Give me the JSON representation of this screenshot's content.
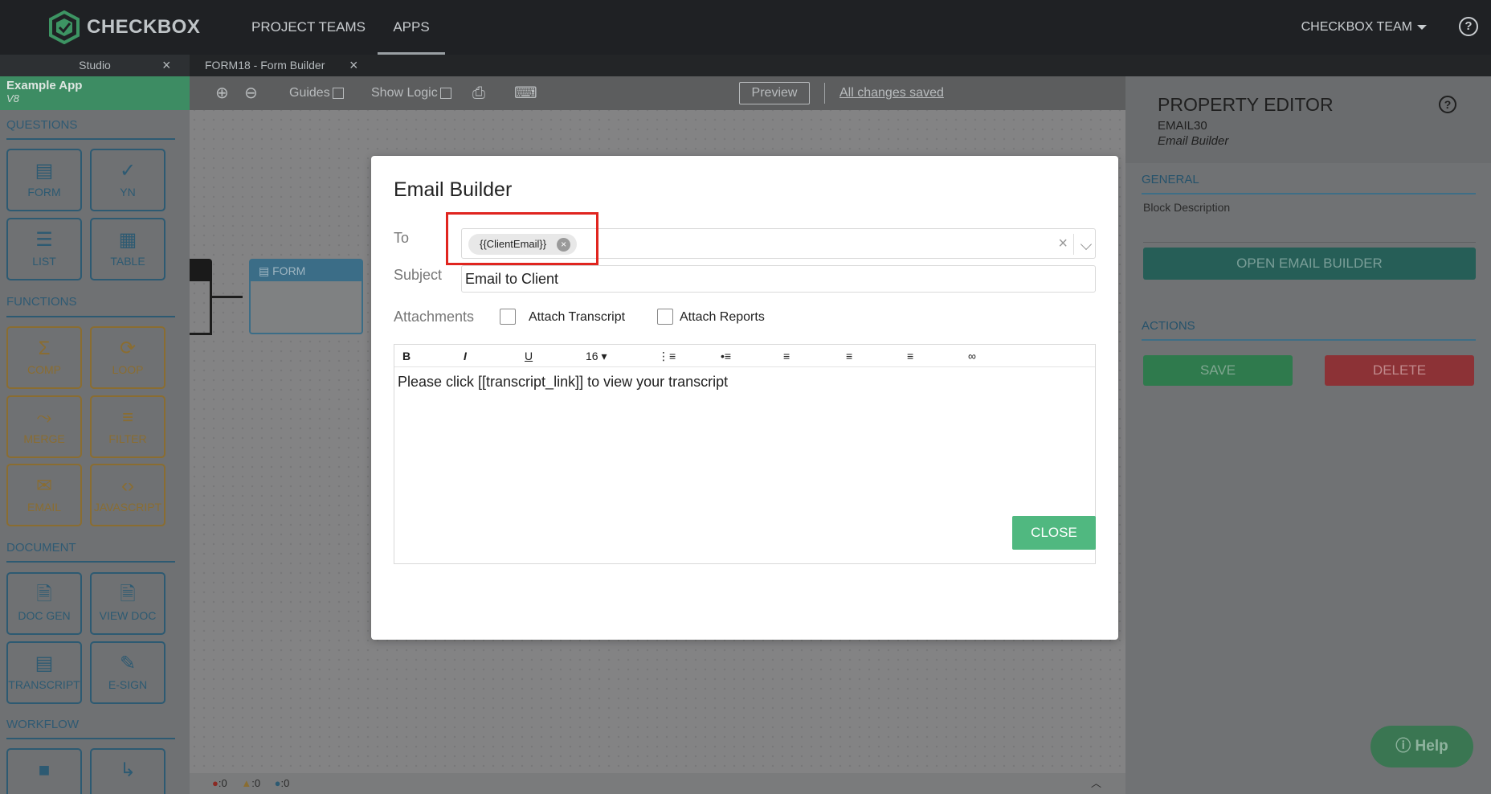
{
  "topnav": {
    "brand": "CHECKBOX",
    "items": [
      {
        "label": "PROJECT TEAMS"
      },
      {
        "label": "APPS"
      }
    ],
    "team": "CHECKBOX TEAM",
    "help": "?"
  },
  "tabs": [
    {
      "label": "Studio"
    },
    {
      "label": "FORM18 - Form Builder"
    }
  ],
  "sidebar": {
    "app_title": "Example App",
    "app_version": "V8",
    "sections": {
      "questions": "QUESTIONS",
      "functions": "FUNCTIONS",
      "document": "DOCUMENT",
      "workflow": "WORKFLOW"
    },
    "tiles": {
      "form": "FORM",
      "yn": "YN",
      "list": "LIST",
      "table": "TABLE",
      "comp": "COMP",
      "loop": "LOOP",
      "merge": "MERGE",
      "filter": "FILTER",
      "email": "EMAIL",
      "javascript": "JAVASCRIPT",
      "docgen": "DOC GEN",
      "viewdoc": "VIEW DOC",
      "transcript": "TRANSCRIPT",
      "esign": "E-SIGN"
    }
  },
  "toolbar": {
    "guides": "Guides",
    "show_logic": "Show Logic",
    "preview": "Preview",
    "saved": "All changes saved"
  },
  "canvas": {
    "form_node": "FORM"
  },
  "status": {
    "errors": ":0",
    "warnings": ":0",
    "info": ":0"
  },
  "property_editor": {
    "title": "PROPERTY EDITOR",
    "id": "EMAIL30",
    "type": "Email Builder",
    "help": "?",
    "general": "GENERAL",
    "block_description": "Block Description",
    "open_email_builder": "OPEN EMAIL BUILDER",
    "actions": "ACTIONS",
    "save": "SAVE",
    "delete": "DELETE"
  },
  "help_widget": "Help",
  "modal": {
    "title": "Email Builder",
    "to_label": "To",
    "to_chip": "{{ClientEmail}}",
    "subject_label": "Subject",
    "subject_value": "Email to Client",
    "attachments_label": "Attachments",
    "attach_transcript": "Attach Transcript",
    "attach_reports": "Attach Reports",
    "editor": {
      "bold": "B",
      "italic": "I",
      "underline": "U",
      "font_size": "16",
      "body": "Please click [[transcript_link]] to view your transcript"
    },
    "close": "CLOSE"
  },
  "colors": {
    "accent_green": "#50b880",
    "highlight_red": "#e0251f",
    "delete_red": "#8c3236",
    "save_green": "#2f7a4d"
  }
}
